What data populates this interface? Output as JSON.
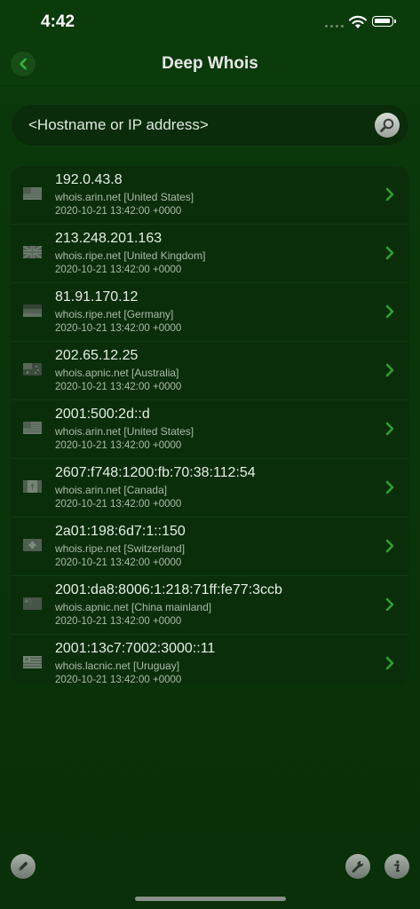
{
  "status_bar": {
    "time": "4:42"
  },
  "nav": {
    "title": "Deep Whois"
  },
  "search": {
    "placeholder": "<Hostname or IP address>"
  },
  "colors": {
    "accent_green": "#2fa12f",
    "background": "#0b3a0b"
  },
  "results": [
    {
      "ip": "192.0.43.8",
      "server": "whois.arin.net [United States]",
      "date": "2020-10-21 13:42:00 +0000",
      "flag": "us"
    },
    {
      "ip": "213.248.201.163",
      "server": "whois.ripe.net [United Kingdom]",
      "date": "2020-10-21 13:42:00 +0000",
      "flag": "gb"
    },
    {
      "ip": "81.91.170.12",
      "server": "whois.ripe.net [Germany]",
      "date": "2020-10-21 13:42:00 +0000",
      "flag": "de"
    },
    {
      "ip": "202.65.12.25",
      "server": "whois.apnic.net [Australia]",
      "date": "2020-10-21 13:42:00 +0000",
      "flag": "au"
    },
    {
      "ip": "2001:500:2d::d",
      "server": "whois.arin.net [United States]",
      "date": "2020-10-21 13:42:00 +0000",
      "flag": "us"
    },
    {
      "ip": "2607:f748:1200:fb:70:38:112:54",
      "server": "whois.arin.net [Canada]",
      "date": "2020-10-21 13:42:00 +0000",
      "flag": "ca"
    },
    {
      "ip": "2a01:198:6d7:1::150",
      "server": "whois.ripe.net [Switzerland]",
      "date": "2020-10-21 13:42:00 +0000",
      "flag": "ch"
    },
    {
      "ip": "2001:da8:8006:1:218:71ff:fe77:3ccb",
      "server": "whois.apnic.net [China mainland]",
      "date": "2020-10-21 13:42:00 +0000",
      "flag": "cn"
    },
    {
      "ip": "2001:13c7:7002:3000::11",
      "server": "whois.lacnic.net [Uruguay]",
      "date": "2020-10-21 13:42:00 +0000",
      "flag": "uy"
    }
  ],
  "bottom_toolbar": {
    "left_icon": "pencil-icon",
    "right_icons": [
      "wrench-icon",
      "info-icon"
    ]
  }
}
